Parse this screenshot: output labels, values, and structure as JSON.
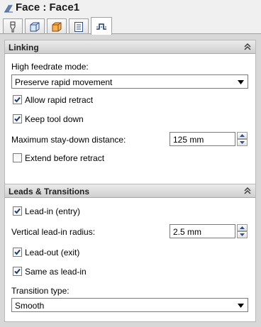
{
  "window": {
    "title": "Face : Face1"
  },
  "tabs": [
    {
      "icon": "tool-icon",
      "active": false
    },
    {
      "icon": "cube-icon",
      "active": false
    },
    {
      "icon": "stock-box-icon",
      "active": false
    },
    {
      "icon": "notes-icon",
      "active": false
    },
    {
      "icon": "linking-icon",
      "active": true
    }
  ],
  "linking": {
    "header": "Linking",
    "high_feedrate_label": "High feedrate mode:",
    "high_feedrate_value": "Preserve rapid movement",
    "allow_rapid_retract_label": "Allow rapid retract",
    "allow_rapid_retract_checked": true,
    "keep_tool_down_label": "Keep tool down",
    "keep_tool_down_checked": true,
    "max_stay_down_label": "Maximum stay-down distance:",
    "max_stay_down_value": "125 mm",
    "extend_before_retract_label": "Extend before retract",
    "extend_before_retract_checked": false
  },
  "leads": {
    "header": "Leads & Transitions",
    "lead_in_label": "Lead-in (entry)",
    "lead_in_checked": true,
    "vertical_lead_in_label": "Vertical lead-in radius:",
    "vertical_lead_in_value": "2.5 mm",
    "lead_out_label": "Lead-out (exit)",
    "lead_out_checked": true,
    "same_as_lead_in_label": "Same as lead-in",
    "same_as_lead_in_checked": true,
    "transition_type_label": "Transition type:",
    "transition_type_value": "Smooth"
  },
  "colors": {
    "panel_bg": "#d8d8d8",
    "section_bg": "#ffffff",
    "checkmark": "#1c3b6e",
    "header_grad_top": "#ebebeb",
    "header_grad_bottom": "#cfcfcf"
  }
}
